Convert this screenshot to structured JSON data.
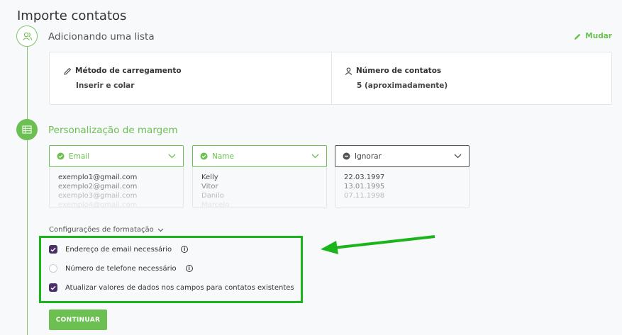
{
  "page": {
    "title": "Importe contatos"
  },
  "step1": {
    "title": "Adicionando uma lista",
    "change_label": "Mudar",
    "upload_method_label": "Método de carregamento",
    "upload_method_value": "Inserir e colar",
    "contact_count_label": "Número de contatos",
    "contact_count_value": "5 (aproximadamente)"
  },
  "step2": {
    "title": "Personalização de margem",
    "columns": [
      {
        "selected": "Email",
        "status": "mapped",
        "rows": [
          "exemplo1@gmail.com",
          "exemplo2@gmail.com",
          "exemplo3@gmail.com",
          "exemplo4@gmail.com"
        ]
      },
      {
        "selected": "Name",
        "status": "mapped",
        "rows": [
          "Kelly",
          "Vitor",
          "Danilo",
          "Marcelo"
        ]
      },
      {
        "selected": "Ignorar",
        "status": "ignored",
        "rows": [
          "22.03.1997",
          "13.01.1995",
          "07.11.1998",
          ""
        ]
      }
    ],
    "format_settings_label": "Configurações de formatação",
    "checkboxes": [
      {
        "label": "Endereço de email necessário",
        "checked": true,
        "info": true
      },
      {
        "label": "Número de telefone necessário",
        "checked": false,
        "info": true
      },
      {
        "label": "Atualizar valores de dados nos campos para contatos existentes",
        "checked": true,
        "info": false
      }
    ],
    "continue_label": "CONTINUAR"
  },
  "colors": {
    "accent": "#6cc052",
    "checkbox": "#4b2f67",
    "highlight": "#1ab51a"
  }
}
